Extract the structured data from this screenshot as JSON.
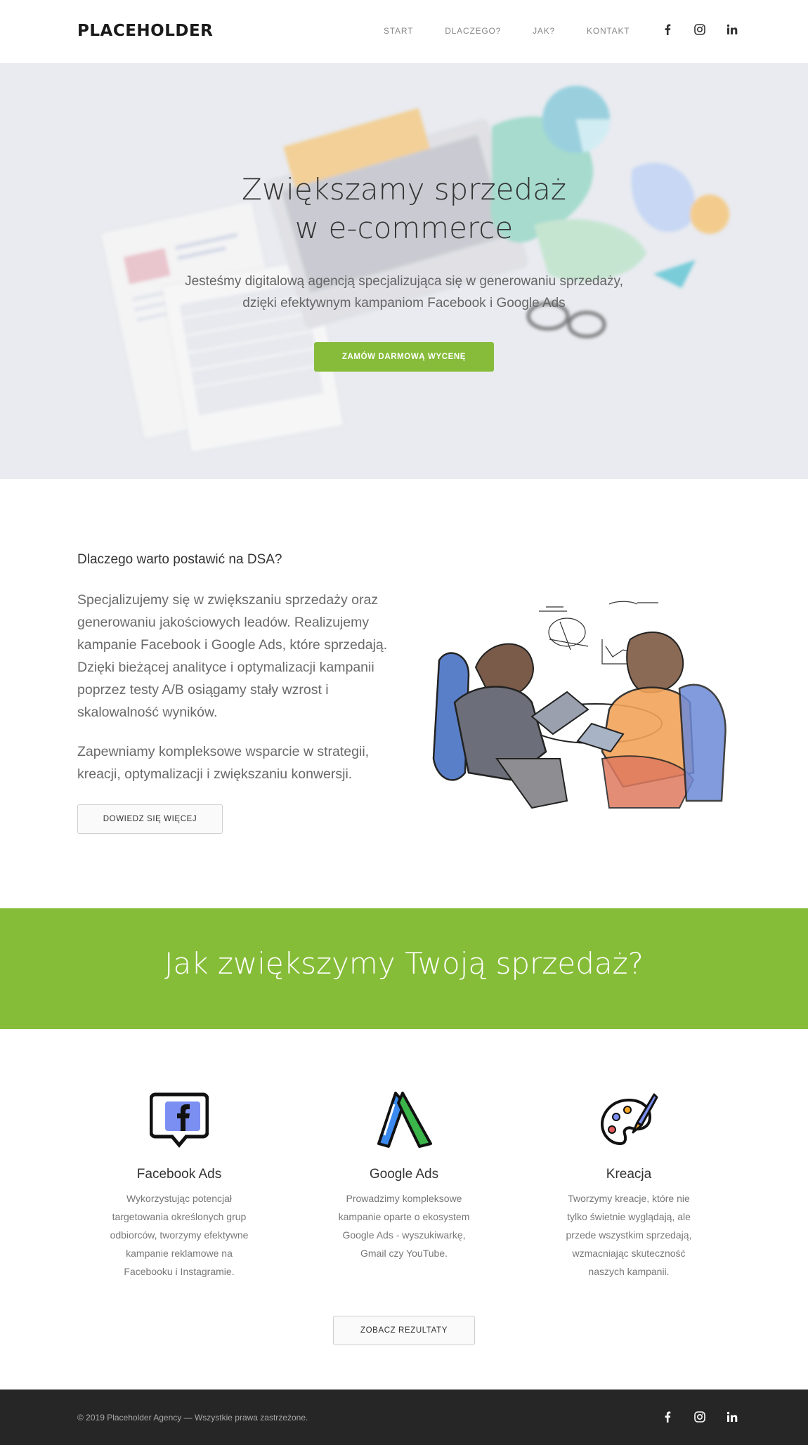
{
  "nav": {
    "logo": "PLACEHOLDER",
    "links": [
      "START",
      "DLACZEGO?",
      "JAK?",
      "KONTAKT"
    ],
    "social": [
      "facebook-icon",
      "instagram-icon",
      "linkedin-icon"
    ]
  },
  "hero": {
    "title_line1": "Zwiększamy sprzedaż",
    "title_line2": "w e-commerce",
    "subtitle_line1": "Jesteśmy digitalową agencją specjalizująca się w generowaniu sprzedaży,",
    "subtitle_line2": "dzięki efektywnym kampaniom Facebook i Google Ads",
    "cta": "ZAMÓW DARMOWĄ WYCENĘ"
  },
  "why": {
    "title": "Dlaczego warto postawić na DSA?",
    "paragraph1": "Specjalizujemy się w zwiększaniu sprzedaży oraz generowaniu jakościowych leadów. Realizujemy kampanie Facebook i Google Ads, które sprzedają. Dzięki bieżącej analityce i optymalizacji kampanii poprzez testy A/B osiągamy stały wzrost i skalowalność wyników.",
    "paragraph2": "Zapewniamy kompleksowe wsparcie w strategii, kreacji, optymalizacji i zwiększaniu konwersji.",
    "button": "DOWIEDZ SIĘ WIĘCEJ"
  },
  "banner": {
    "title": "Jak zwiększymy Twoją sprzedaż?"
  },
  "services": [
    {
      "icon": "facebook-ads-icon",
      "title": "Facebook Ads",
      "desc": "Wykorzystując potencjał targetowania określonych grup odbiorców, tworzymy efektywne kampanie reklamowe na Facebooku i Instagramie."
    },
    {
      "icon": "google-ads-icon",
      "title": "Google Ads",
      "desc": "Prowadzimy kompleksowe kampanie oparte o ekosystem Google Ads - wyszukiwarkę, Gmail czy  YouTube."
    },
    {
      "icon": "palette-icon",
      "title": "Kreacja",
      "desc": "Tworzymy kreacje, które nie tylko świetnie wyglądają, ale przede wszystkim sprzedają, wzmacniając skuteczność naszych kampanii."
    }
  ],
  "results_button": "ZOBACZ REZULTATY",
  "footer": {
    "copyright": "© 2019 Placeholder Agency — Wszystkie prawa zastrzeżone."
  },
  "colors": {
    "accent": "#86bc3a",
    "hero_bg": "#e9ebf0",
    "footer_bg": "#262626"
  }
}
